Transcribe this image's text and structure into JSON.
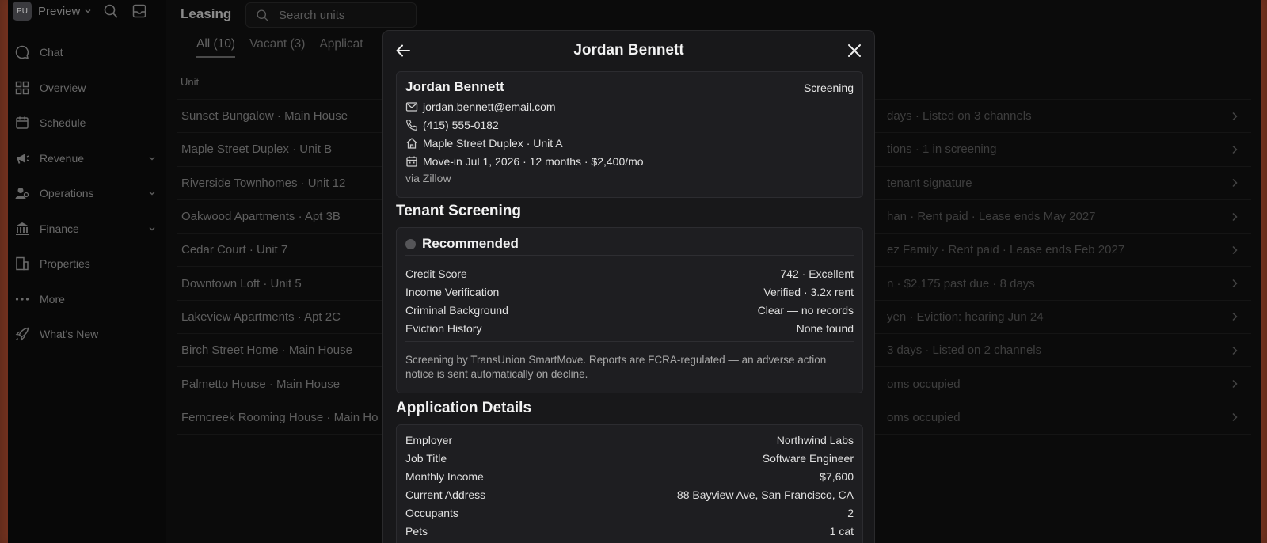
{
  "workspace": {
    "initials": "PU",
    "name": "Preview"
  },
  "nav": [
    {
      "label": "Chat",
      "icon": "chat-icon",
      "expandable": false
    },
    {
      "label": "Overview",
      "icon": "grid-icon",
      "expandable": false
    },
    {
      "label": "Schedule",
      "icon": "calendar-icon",
      "expandable": false
    },
    {
      "label": "Revenue",
      "icon": "megaphone-icon",
      "expandable": true
    },
    {
      "label": "Operations",
      "icon": "people-icon",
      "expandable": true
    },
    {
      "label": "Finance",
      "icon": "bank-icon",
      "expandable": true
    },
    {
      "label": "Properties",
      "icon": "building-icon",
      "expandable": false
    },
    {
      "label": "More",
      "icon": "more-icon",
      "expandable": false
    },
    {
      "label": "What's New",
      "icon": "rocket-icon",
      "expandable": false
    }
  ],
  "main": {
    "title": "Leasing",
    "search_placeholder": "Search units",
    "tabs": [
      {
        "label": "All (10)",
        "active": true
      },
      {
        "label": "Vacant (3)",
        "active": false
      },
      {
        "label": "Applicat",
        "active": false
      }
    ],
    "column_header": "Unit",
    "rows": [
      {
        "unit": "Sunset Bungalow · Main House",
        "status": "days · Listed on 3 channels"
      },
      {
        "unit": "Maple Street Duplex · Unit B",
        "status": "tions · 1 in screening"
      },
      {
        "unit": "Riverside Townhomes · Unit 12",
        "status": "tenant signature"
      },
      {
        "unit": "Oakwood Apartments · Apt 3B",
        "status": "han · Rent paid · Lease ends May 2027"
      },
      {
        "unit": "Cedar Court · Unit 7",
        "status": "ez Family · Rent paid · Lease ends Feb 2027"
      },
      {
        "unit": "Downtown Loft · Unit 5",
        "status": "n · $2,175 past due · 8 days"
      },
      {
        "unit": "Lakeview Apartments · Apt 2C",
        "status": "yen · Eviction: hearing Jun 24"
      },
      {
        "unit": "Birch Street Home · Main House",
        "status": "3 days · Listed on 2 channels"
      },
      {
        "unit": "Palmetto House · Main House",
        "status": "oms occupied"
      },
      {
        "unit": "Ferncreek Rooming House · Main Ho",
        "status": "oms occupied"
      }
    ]
  },
  "modal": {
    "title": "Jordan Bennett",
    "candidate": {
      "name": "Jordan Bennett",
      "status": "Screening",
      "email": "jordan.bennett@email.com",
      "phone": "(415) 555-0182",
      "property": "Maple Street Duplex · Unit A",
      "move_in": "Move-in Jul 1, 2026 · 12 months · $2,400/mo",
      "source": "via Zillow"
    },
    "screening": {
      "section_title": "Tenant Screening",
      "result": "Recommended",
      "items": [
        {
          "label": "Credit Score",
          "value": "742 · Excellent"
        },
        {
          "label": "Income Verification",
          "value": "Verified · 3.2x rent"
        },
        {
          "label": "Criminal Background",
          "value": "Clear — no records"
        },
        {
          "label": "Eviction History",
          "value": "None found"
        }
      ],
      "note": "Screening by TransUnion SmartMove. Reports are FCRA-regulated — an adverse action notice is sent automatically on decline."
    },
    "application": {
      "section_title": "Application Details",
      "items": [
        {
          "label": "Employer",
          "value": "Northwind Labs"
        },
        {
          "label": "Job Title",
          "value": "Software Engineer"
        },
        {
          "label": "Monthly Income",
          "value": "$7,600"
        },
        {
          "label": "Current Address",
          "value": "88 Bayview Ave, San Francisco, CA"
        },
        {
          "label": "Occupants",
          "value": "2"
        },
        {
          "label": "Pets",
          "value": "1 cat"
        }
      ]
    }
  }
}
